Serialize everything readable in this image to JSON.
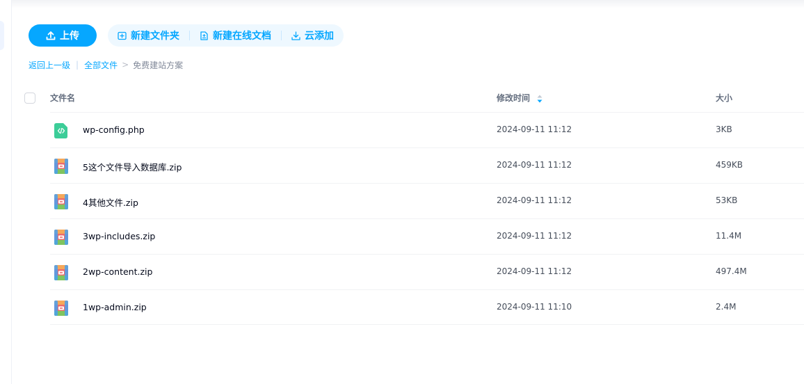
{
  "toolbar": {
    "upload_label": "上传",
    "new_folder_label": "新建文件夹",
    "new_online_doc_label": "新建在线文档",
    "cloud_add_label": "云添加"
  },
  "breadcrumb": {
    "back_label": "返回上一级",
    "separator": "|",
    "all_files_label": "全部文件",
    "arrow": ">",
    "current_label": "免费建站方案"
  },
  "table": {
    "columns": {
      "name": "文件名",
      "modified": "修改时间",
      "size": "大小"
    },
    "rows": [
      {
        "name": "wp-config.php",
        "time": "2024-09-11 11:12",
        "size": "3KB",
        "icon": "code-file-icon"
      },
      {
        "name": "5这个文件导入数据库.zip",
        "time": "2024-09-11 11:12",
        "size": "459KB",
        "icon": "zip-file-icon"
      },
      {
        "name": "4其他文件.zip",
        "time": "2024-09-11 11:12",
        "size": "53KB",
        "icon": "zip-file-icon"
      },
      {
        "name": "3wp-includes.zip",
        "time": "2024-09-11 11:12",
        "size": "11.4M",
        "icon": "zip-file-icon"
      },
      {
        "name": "2wp-content.zip",
        "time": "2024-09-11 11:12",
        "size": "497.4M",
        "icon": "zip-file-icon"
      },
      {
        "name": "1wp-admin.zip",
        "time": "2024-09-11 11:10",
        "size": "2.4M",
        "icon": "zip-file-icon"
      }
    ]
  },
  "colors": {
    "accent": "#06a7ff",
    "accent_soft": "#eef8ff",
    "code_icon": "#3ccd98"
  }
}
